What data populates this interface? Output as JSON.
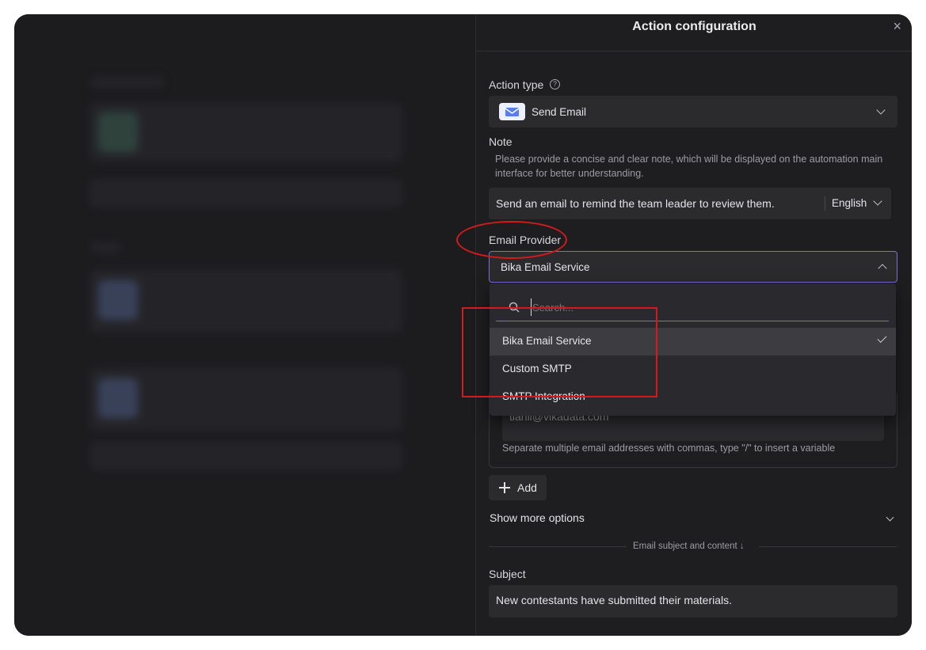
{
  "panel": {
    "title": "Action configuration",
    "close_icon": "×"
  },
  "action_type": {
    "label": "Action type",
    "value": "Send Email"
  },
  "note": {
    "label": "Note",
    "hint_line1": "Please provide a concise and clear note, which will be displayed on the automation main",
    "hint_line2": "interface for better understanding.",
    "value": "Send an email to remind the team leader to review them.",
    "language": "English"
  },
  "email_provider": {
    "label": "Email Provider",
    "value": "Bika Email Service",
    "search_placeholder": "Search...",
    "options": [
      {
        "label": "Bika Email Service",
        "selected": true
      },
      {
        "label": "Custom SMTP",
        "selected": false
      },
      {
        "label": "SMTP Integration",
        "selected": false
      }
    ]
  },
  "recipients": {
    "email_value": "tianli@vikadata.com",
    "hint": "Separate multiple email addresses with commas, type \"/\" to insert a variable"
  },
  "add_button": "Add",
  "show_more": "Show more options",
  "divider_text": "Email subject and content ↓",
  "subject": {
    "label": "Subject",
    "value": "New contestants have submitted their materials."
  },
  "colors": {
    "accent": "#7b6fd6",
    "annotation": "#d31b1b"
  }
}
